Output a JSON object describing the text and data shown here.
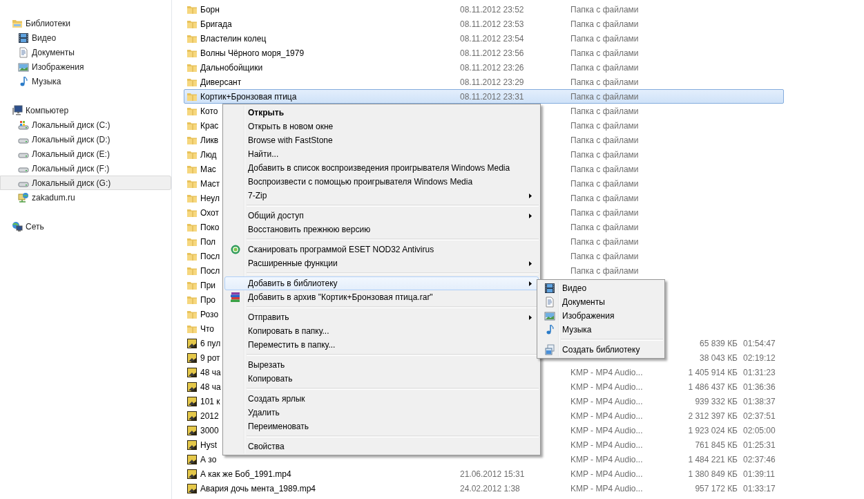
{
  "sidebar": {
    "groups": [
      {
        "label": "Библиотеки",
        "selected": false,
        "children": [
          {
            "label": "Видео",
            "selected": false
          },
          {
            "label": "Документы",
            "selected": false
          },
          {
            "label": "Изображения",
            "selected": false
          },
          {
            "label": "Музыка",
            "selected": false
          }
        ]
      },
      {
        "label": "Компьютер",
        "selected": false,
        "children": [
          {
            "label": "Локальный диск (C:)",
            "selected": false
          },
          {
            "label": "Локальный диск (D:)",
            "selected": false
          },
          {
            "label": "Локальный диск (E:)",
            "selected": false
          },
          {
            "label": "Локальный диск (F:)",
            "selected": false
          },
          {
            "label": "Локальный диск (G:)",
            "selected": true
          },
          {
            "label": "zakadum.ru",
            "selected": false
          }
        ]
      },
      {
        "label": "Сеть",
        "selected": false
      }
    ]
  },
  "files": {
    "rows": [
      {
        "kind": "folder",
        "name": "Борн",
        "date": "08.11.2012 23:52",
        "type": "Папка с файлами",
        "selected": false
      },
      {
        "kind": "folder",
        "name": "Бригада",
        "date": "08.11.2012 23:53",
        "type": "Папка с файлами",
        "selected": false
      },
      {
        "kind": "folder",
        "name": "Властелин колец",
        "date": "08.11.2012 23:54",
        "type": "Папка с файлами",
        "selected": false
      },
      {
        "kind": "folder",
        "name": "Волны Чёрного моря_1979",
        "date": "08.11.2012 23:56",
        "type": "Папка с файлами",
        "selected": false
      },
      {
        "kind": "folder",
        "name": "Дальнобойщики",
        "date": "08.11.2012 23:26",
        "type": "Папка с файлами",
        "selected": false
      },
      {
        "kind": "folder",
        "name": "Диверсант",
        "date": "08.11.2012 23:29",
        "type": "Папка с файлами",
        "selected": false
      },
      {
        "kind": "folder",
        "name": "Кортик+Бронзовая птица",
        "date": "08.11.2012 23:31",
        "type": "Папка с файлами",
        "selected": true
      },
      {
        "kind": "folder",
        "name": "Кото",
        "type": "Папка с файлами",
        "selected": false
      },
      {
        "kind": "folder",
        "name": "Крас",
        "type": "Папка с файлами",
        "selected": false
      },
      {
        "kind": "folder",
        "name": "Ликв",
        "type": "Папка с файлами",
        "selected": false
      },
      {
        "kind": "folder",
        "name": "Люд",
        "type": "Папка с файлами",
        "selected": false
      },
      {
        "kind": "folder",
        "name": "Мас",
        "type": "Папка с файлами",
        "selected": false
      },
      {
        "kind": "folder",
        "name": "Маст",
        "type": "Папка с файлами",
        "selected": false
      },
      {
        "kind": "folder",
        "name": "Неул",
        "type": "Папка с файлами",
        "selected": false
      },
      {
        "kind": "folder",
        "name": "Охот",
        "type": "Папка с файлами",
        "selected": false
      },
      {
        "kind": "folder",
        "name": "Поко",
        "type": "Папка с файлами",
        "selected": false
      },
      {
        "kind": "folder",
        "name": "Пол",
        "type": "Папка с файлами",
        "selected": false
      },
      {
        "kind": "folder",
        "name": "Посл",
        "type": "Папка с файлами",
        "selected": false
      },
      {
        "kind": "folder",
        "name": "Посл",
        "type": "Папка с файлами",
        "selected": false
      },
      {
        "kind": "folder",
        "name": "При",
        "selected": false
      },
      {
        "kind": "folder",
        "name": "Про",
        "selected": false
      },
      {
        "kind": "folder",
        "name": "Розо",
        "selected": false
      },
      {
        "kind": "folder",
        "name": "Что",
        "selected": false
      },
      {
        "kind": "video",
        "name": "6 пул",
        "size": "65 839 КБ",
        "duration": "01:54:47",
        "selected": false
      },
      {
        "kind": "video",
        "name": "9 рот",
        "size": "38 043 КБ",
        "duration": "02:19:12",
        "selected": false
      },
      {
        "kind": "video",
        "name": "48 ча",
        "type": "KMP - MP4 Audio...",
        "size": "1 405 914 КБ",
        "duration": "01:31:23",
        "selected": false
      },
      {
        "kind": "video",
        "name": "48 ча",
        "type": "KMP - MP4 Audio...",
        "size": "1 486 437 КБ",
        "duration": "01:36:36",
        "selected": false
      },
      {
        "kind": "video",
        "name": "101 к",
        "type": "KMP - MP4 Audio...",
        "size": "939 332 КБ",
        "duration": "01:38:37",
        "selected": false
      },
      {
        "kind": "video",
        "name": "2012",
        "type": "KMP - MP4 Audio...",
        "size": "2 312 397 КБ",
        "duration": "02:37:51",
        "selected": false
      },
      {
        "kind": "video",
        "name": "3000",
        "type": "KMP - MP4 Audio...",
        "size": "1 923 024 КБ",
        "duration": "02:05:00",
        "selected": false
      },
      {
        "kind": "video",
        "name": "Hyst",
        "type": "KMP - MP4 Audio...",
        "size": "761 845 КБ",
        "duration": "01:25:31",
        "selected": false
      },
      {
        "kind": "video",
        "name": "А зо",
        "type": "KMP - MP4 Audio...",
        "size": "1 484 221 КБ",
        "duration": "02:37:46",
        "selected": false
      },
      {
        "kind": "video",
        "name": "А как же Боб_1991.mp4",
        "date": "21.06.2012 15:31",
        "type": "KMP - MP4 Audio...",
        "size": "1 380 849 КБ",
        "duration": "01:39:11",
        "selected": false
      },
      {
        "kind": "video",
        "name": "Авария дочь мента_1989.mp4",
        "date": "24.02.2012 1:38",
        "type": "KMP - MP4 Audio...",
        "size": "957 172 КБ",
        "duration": "01:33:17",
        "selected": false
      }
    ]
  },
  "context_menu": {
    "groups": [
      [
        {
          "label": "Открыть",
          "bold": true,
          "submenu": false,
          "selected": false
        },
        {
          "label": "Открыть в новом окне",
          "bold": false,
          "submenu": false,
          "selected": false
        },
        {
          "label": "Browse with FastStone",
          "bold": false,
          "submenu": false,
          "selected": false
        },
        {
          "label": "Найти...",
          "bold": false,
          "submenu": false,
          "selected": false
        },
        {
          "label": "Добавить в список воспроизведения проигрывателя Windows Media",
          "bold": false,
          "submenu": false,
          "selected": false
        },
        {
          "label": "Воспроизвести с помощью проигрывателя Windows Media",
          "bold": false,
          "submenu": false,
          "selected": false
        },
        {
          "label": "7-Zip",
          "bold": false,
          "submenu": true,
          "selected": false
        }
      ],
      [
        {
          "label": "Общий доступ",
          "bold": false,
          "submenu": true,
          "selected": false
        },
        {
          "label": "Восстановить прежнюю версию",
          "bold": false,
          "submenu": false,
          "selected": false
        }
      ],
      [
        {
          "label": "Сканировать программой ESET NOD32 Antivirus",
          "bold": false,
          "submenu": false,
          "selected": false
        },
        {
          "label": "Расширенные функции",
          "bold": false,
          "submenu": true,
          "selected": false
        }
      ],
      [
        {
          "label": "Добавить в библиотеку",
          "bold": false,
          "submenu": true,
          "selected": true
        },
        {
          "label": "Добавить в архив \"Кортик+Бронзовая птица.rar\"",
          "bold": false,
          "submenu": false,
          "selected": false
        }
      ],
      [
        {
          "label": "Отправить",
          "bold": false,
          "submenu": true,
          "selected": false
        },
        {
          "label": "Копировать в папку...",
          "bold": false,
          "submenu": false,
          "selected": false
        },
        {
          "label": "Переместить в папку...",
          "bold": false,
          "submenu": false,
          "selected": false
        }
      ],
      [
        {
          "label": "Вырезать",
          "bold": false,
          "submenu": false,
          "selected": false
        },
        {
          "label": "Копировать",
          "bold": false,
          "submenu": false,
          "selected": false
        }
      ],
      [
        {
          "label": "Создать ярлык",
          "bold": false,
          "submenu": false,
          "selected": false
        },
        {
          "label": "Удалить",
          "bold": false,
          "submenu": false,
          "selected": false
        },
        {
          "label": "Переименовать",
          "bold": false,
          "submenu": false,
          "selected": false
        }
      ],
      [
        {
          "label": "Свойства",
          "bold": false,
          "submenu": false,
          "selected": false
        }
      ]
    ]
  },
  "library_submenu": {
    "groups": [
      [
        {
          "label": "Видео",
          "selected": false
        },
        {
          "label": "Документы",
          "selected": false
        },
        {
          "label": "Изображения",
          "selected": false
        },
        {
          "label": "Музыка",
          "selected": false
        }
      ],
      [
        {
          "label": "Создать библиотеку",
          "selected": false
        }
      ]
    ]
  }
}
